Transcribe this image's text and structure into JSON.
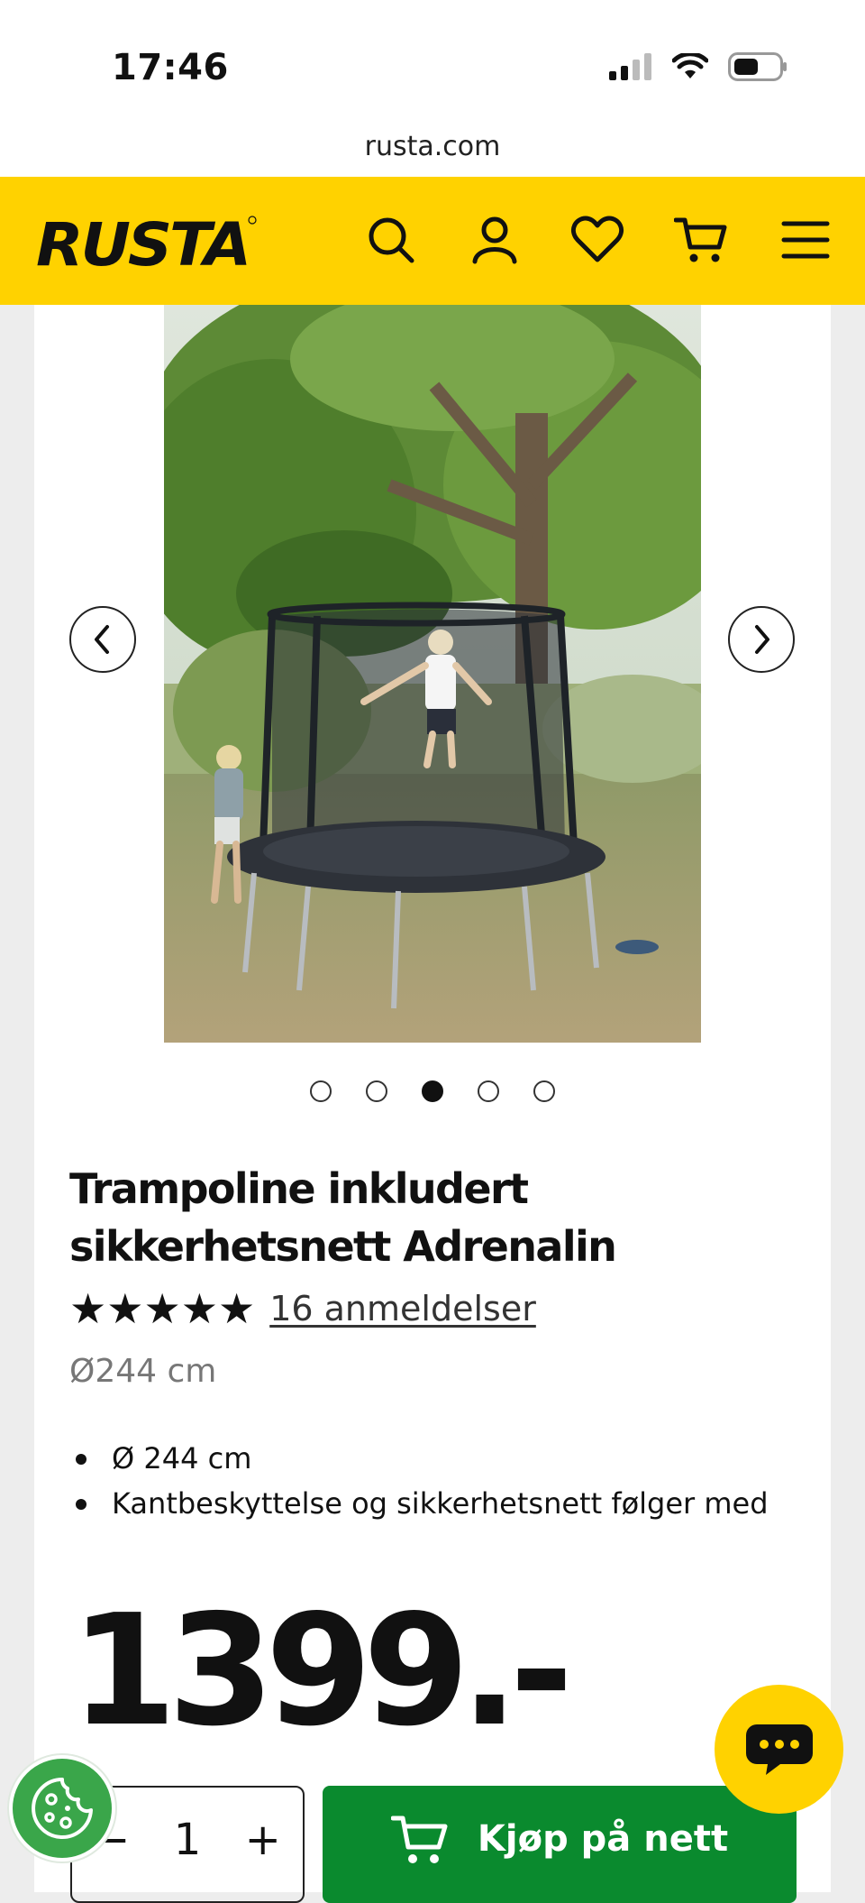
{
  "status_bar": {
    "time": "17:46"
  },
  "browser": {
    "url": "rusta.com"
  },
  "header": {
    "logo": "RUSTA",
    "icons": [
      "search-icon",
      "account-icon",
      "heart-icon",
      "cart-icon",
      "menu-icon"
    ],
    "brand_color": "#ffd200"
  },
  "gallery": {
    "slide_count": 5,
    "active_index": 2,
    "prev_icon": "chevron-left-icon",
    "next_icon": "chevron-right-icon"
  },
  "product": {
    "title": "Trampoline inkludert sikkerhetsnett Adrenalin",
    "stars": "★★★★★",
    "rating": 5,
    "reviews_label": "16 anmeldelser",
    "diameter": "Ø244 cm",
    "features": [
      "Ø 244 cm",
      "Kantbeskyttelse og sikkerhetsnett følger med"
    ],
    "price": "1399.-"
  },
  "purchase": {
    "qty_minus": "−",
    "qty_value": "1",
    "qty_plus": "+",
    "buy_label": "Kjøp på nett",
    "buy_color": "#0a8a2e"
  },
  "floating": {
    "chat_icon": "chat-icon",
    "cookie_icon": "cookie-icon"
  }
}
